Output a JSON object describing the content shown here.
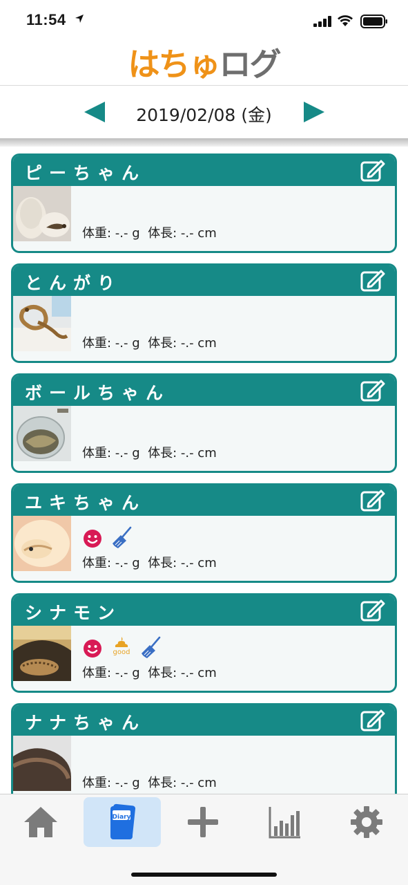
{
  "status_bar": {
    "time": "11:54"
  },
  "header": {
    "logo_part1": "はちゅ",
    "logo_part2": "ログ"
  },
  "date_nav": {
    "date": "2019/02/08 (金)"
  },
  "pets": [
    {
      "name": "ピーちゃん",
      "measure": "体重: -.- g  体長: -.- cm",
      "icons": []
    },
    {
      "name": "とんがり",
      "measure": "体重: -.- g  体長: -.- cm",
      "icons": []
    },
    {
      "name": "ボールちゃん",
      "measure": "体重: -.- g  体長: -.- cm",
      "icons": []
    },
    {
      "name": "ユキちゃん",
      "measure": "体重: -.- g  体長: -.- cm",
      "icons": [
        "smile-icon",
        "broom-icon"
      ]
    },
    {
      "name": "シナモン",
      "measure": "体重: -.- g  体長: -.- cm",
      "icons": [
        "smile-icon",
        "poop-good-icon",
        "broom-icon"
      ],
      "poop_label": "good"
    },
    {
      "name": "ナナちゃん",
      "measure": "体重: -.- g  体長: -.- cm",
      "icons": []
    }
  ],
  "tabs": [
    {
      "name": "home",
      "icon": "home-icon"
    },
    {
      "name": "diary",
      "icon": "diary-icon",
      "label": "Diary",
      "active": true
    },
    {
      "name": "add",
      "icon": "plus-icon"
    },
    {
      "name": "graph",
      "icon": "bar-chart-icon"
    },
    {
      "name": "settings",
      "icon": "gear-icon"
    }
  ],
  "colors": {
    "accent": "#168a87",
    "logo_orange": "#ef9218",
    "logo_gray": "#6e6e6e",
    "smile": "#d81a55",
    "broom": "#3a6fc4",
    "poop": "#e8a325",
    "tab_active_bg": "#d1e5f8",
    "diary_blue": "#1f6fe0"
  }
}
